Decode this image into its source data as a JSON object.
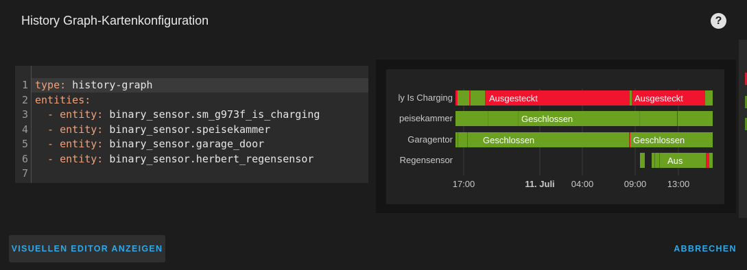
{
  "dialog": {
    "title": "History Graph-Kartenkonfiguration",
    "help_icon": "help-circle-icon"
  },
  "editor": {
    "lines": [
      {
        "num": "1",
        "key": "type:",
        "value": " history-graph"
      },
      {
        "num": "2",
        "key": "entities:",
        "value": ""
      },
      {
        "num": "3",
        "key": "  - entity:",
        "value": " binary_sensor.sm_g973f_is_charging"
      },
      {
        "num": "4",
        "key": "  - entity:",
        "value": " binary_sensor.speisekammer"
      },
      {
        "num": "5",
        "key": "  - entity:",
        "value": " binary_sensor.garage_door"
      },
      {
        "num": "6",
        "key": "  - entity:",
        "value": " binary_sensor.herbert_regensensor"
      },
      {
        "num": "7",
        "key": "",
        "value": ""
      }
    ]
  },
  "chart_data": {
    "type": "timeline",
    "x_ticks": [
      "17:00",
      "11. Juli",
      "04:00",
      "09:00",
      "13:00"
    ],
    "rows": [
      {
        "label": "ly Is Charging",
        "segment_labels": [
          "Ausgesteckt",
          "Ausgesteckt"
        ]
      },
      {
        "label": "peisekammer",
        "segment_labels": [
          "Geschlossen"
        ]
      },
      {
        "label": "Garagentor",
        "segment_labels": [
          "Geschlossen",
          "Geschlossen"
        ]
      },
      {
        "label": "Regensensor",
        "segment_labels": [
          "Aus"
        ]
      }
    ],
    "colors": {
      "on_green": "#6aa121",
      "off_red": "#f0142f"
    }
  },
  "buttons": {
    "visual_editor": "VISUELLEN EDITOR ANZEIGEN",
    "cancel": "ABBRECHEN"
  }
}
